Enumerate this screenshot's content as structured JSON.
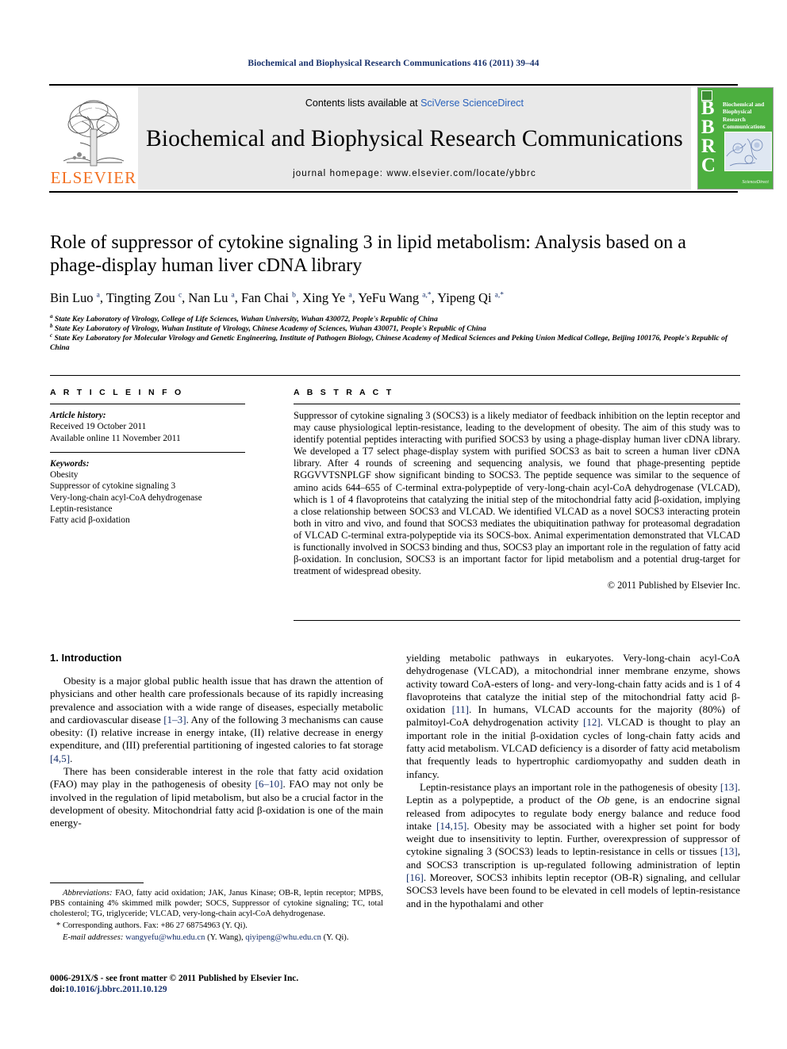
{
  "running_head": "Biochemical and Biophysical Research Communications 416 (2011) 39–44",
  "masthead": {
    "contents_prefix": "Contents lists available at ",
    "sciencedirect_link": "SciVerse ScienceDirect",
    "journal_name": "Biochemical and Biophysical Research Communications",
    "homepage": "journal homepage: www.elsevier.com/locate/ybbrc",
    "elsevier_wordmark": "ELSEVIER",
    "cover": {
      "letters": "B\nB\nR\nC",
      "title": "Biochemical and Biophysical Research Communications",
      "publisher_mark": "ScienceDirect",
      "bg_color": "#4caf3f"
    },
    "accent_link_color": "#2a62bc",
    "elsevier_orange": "#F37021"
  },
  "article": {
    "title": "Role of suppressor of cytokine signaling 3 in lipid metabolism: Analysis based on a phage-display human liver cDNA library",
    "authors_html": "Bin Luo <sup>a</sup>, Tingting Zou <sup>c</sup>, Nan Lu <sup>a</sup>, Fan Chai <sup>b</sup>, Xing Ye <sup>a</sup>, YeFu Wang <sup>a,*</sup>, Yipeng Qi <sup>a,*</sup>",
    "affiliations": [
      "<sup>a</sup> State Key Laboratory of Virology, College of Life Sciences, Wuhan University, Wuhan 430072, People's Republic of China",
      "<sup>b</sup> State Key Laboratory of Virology, Wuhan Institute of Virology, Chinese Academy of Sciences, Wuhan 430071, People's Republic of China",
      "<sup>c</sup> State Key Laboratory for Molecular Virology and Genetic Engineering, Institute of Pathogen Biology, Chinese Academy of Medical Sciences and Peking Union Medical College, Beijing 100176, People's Republic of China"
    ]
  },
  "article_info": {
    "heading": "A R T I C L E  I N F O",
    "history_label": "Article history:",
    "history": [
      "Received 19 October 2011",
      "Available online 11 November 2011"
    ],
    "keywords_label": "Keywords:",
    "keywords": [
      "Obesity",
      "Suppressor of cytokine signaling 3",
      "Very-long-chain acyl-CoA dehydrogenase",
      "Leptin-resistance",
      "Fatty acid β-oxidation"
    ]
  },
  "abstract": {
    "heading": "A B S T R A C T",
    "text": "Suppressor of cytokine signaling 3 (SOCS3) is a likely mediator of feedback inhibition on the leptin receptor and may cause physiological leptin-resistance, leading to the development of obesity. The aim of this study was to identify potential peptides interacting with purified SOCS3 by using a phage-display human liver cDNA library. We developed a T7 select phage-display system with purified SOCS3 as bait to screen a human liver cDNA library. After 4 rounds of screening and sequencing analysis, we found that phage-presenting peptide RGGVVTSNPLGF show significant binding to SOCS3. The peptide sequence was similar to the sequence of amino acids 644–655 of C-terminal extra-polypeptide of very-long-chain acyl-CoA dehydrogenase (VLCAD), which is 1 of 4 flavoproteins that catalyzing the initial step of the mitochondrial fatty acid β-oxidation, implying a close relationship between SOCS3 and VLCAD. We identified VLCAD as a novel SOCS3 interacting protein both in vitro and vivo, and found that SOCS3 mediates the ubiquitination pathway for proteasomal degradation of VLCAD C-terminal extra-polypeptide via its SOCS-box. Animal experimentation demonstrated that VLCAD is functionally involved in SOCS3 binding and thus, SOCS3 play an important role in the regulation of fatty acid β-oxidation. In conclusion, SOCS3 is an important factor for lipid metabolism and a potential drug-target for treatment of widespread obesity.",
    "copyright": "© 2011 Published by Elsevier Inc."
  },
  "introduction": {
    "heading": "1. Introduction",
    "left_paragraphs": [
      "Obesity is a major global public health issue that has drawn the attention of physicians and other health care professionals because of its rapidly increasing prevalence and association with a wide range of diseases, especially metabolic and cardiovascular disease <span class=\"ref\">[1–3]</span>. Any of the following 3 mechanisms can cause obesity: (I) relative increase in energy intake, (II) relative decrease in energy expenditure, and (III) preferential partitioning of ingested calories to fat storage <span class=\"ref\">[4,5]</span>.",
      "There has been considerable interest in the role that fatty acid oxidation (FAO) may play in the pathogenesis of obesity <span class=\"ref\">[6–10]</span>. FAO may not only be involved in the regulation of lipid metabolism, but also be a crucial factor in the development of obesity. Mitochondrial fatty acid β-oxidation is one of the main energy-"
    ],
    "right_paragraphs": [
      "yielding metabolic pathways in eukaryotes. Very-long-chain acyl-CoA dehydrogenase (VLCAD), a mitochondrial inner membrane enzyme, shows activity toward CoA-esters of long- and very-long-chain fatty acids and is 1 of 4 flavoproteins that catalyze the initial step of the mitochondrial fatty acid β-oxidation <span class=\"ref\">[11]</span>. In humans, VLCAD accounts for the majority (80%) of palmitoyl-CoA dehydrogenation activity <span class=\"ref\">[12]</span>. VLCAD is thought to play an important role in the initial β-oxidation cycles of long-chain fatty acids and fatty acid metabolism. VLCAD deficiency is a disorder of fatty acid metabolism that frequently leads to hypertrophic cardiomyopathy and sudden death in infancy.",
      "Leptin-resistance plays an important role in the pathogenesis of obesity <span class=\"ref\">[13]</span>. Leptin as a polypeptide, a product of the <span class=\"itl\">Ob</span> gene, is an endocrine signal released from adipocytes to regulate body energy balance and reduce food intake <span class=\"ref\">[14,15]</span>. Obesity may be associated with a higher set point for body weight due to insensitivity to leptin. Further, overexpression of suppressor of cytokine signaling 3 (SOCS3) leads to leptin-resistance in cells or tissues <span class=\"ref\">[13]</span>, and SOCS3 transcription is up-regulated following administration of leptin <span class=\"ref\">[16]</span>. Moreover, SOCS3 inhibits leptin receptor (OB-R) signaling, and cellular SOCS3 levels have been found to be elevated in cell models of leptin-resistance and in the hypothalami and other"
    ]
  },
  "footnotes": {
    "abbreviations_html": "<span class=\"fn-em\">Abbreviations:</span> FAO, fatty acid oxidation; JAK, Janus Kinase; OB-R, leptin receptor; MPBS, PBS containing 4% skimmed milk powder; SOCS, Suppressor of cytokine signaling; TC, total cholesterol; TG, triglyceride; VLCAD, very-long-chain acyl-CoA dehydrogenase.",
    "corresponding_html": "* Corresponding authors. Fax: +86 27 68754963 (Y. Qi).",
    "email_html": "<span class=\"fn-em\">E-mail addresses:</span> <span class=\"mail-link\">wangyefu@whu.edu.cn</span> (Y. Wang), <span class=\"mail-link\">qiyipeng@whu.edu.cn</span> (Y. Qi)."
  },
  "page_footer": {
    "front_matter": "0006-291X/$ - see front matter © 2011 Published by Elsevier Inc.",
    "doi_prefix": "doi:",
    "doi": "10.1016/j.bbrc.2011.10.129"
  }
}
